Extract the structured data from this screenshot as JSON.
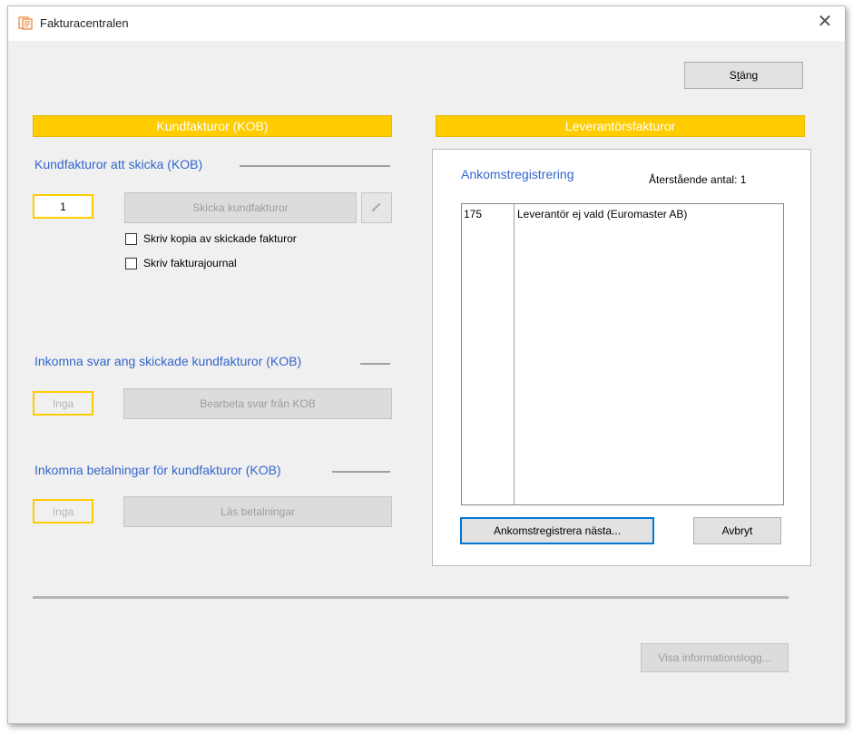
{
  "window": {
    "title": "Fakturacentralen"
  },
  "buttons": {
    "close_first": "S",
    "close_underlined": "t",
    "close_rest": "äng",
    "send_invoices": "Skicka kundfakturor",
    "process_replies": "Bearbeta svar från KOB",
    "read_payments": "Läs betalningar",
    "register_next": "Ankomstregistrera nästa...",
    "cancel": "Avbryt",
    "show_log": "Visa informationslogg..."
  },
  "customer": {
    "header": "Kundfakturor (KOB)",
    "to_send": {
      "title": "Kundfakturor att skicka (KOB)",
      "count": "1",
      "checkbox_copy": "Skriv kopia av skickade fakturor",
      "checkbox_journal": "Skriv fakturajournal"
    },
    "replies": {
      "title": "Inkomna svar ang skickade kundfakturor (KOB)",
      "count": "Inga"
    },
    "payments": {
      "title": "Inkomna betalningar för kundfakturor (KOB)",
      "count": "Inga"
    }
  },
  "supplier": {
    "header": "Leverantörsfakturor",
    "arrival": {
      "title": "Ankomstregistrering",
      "remaining_label": "Återstående antal: 1",
      "rows": [
        {
          "number": "175",
          "text": "Leverantör ej vald (Euromaster AB)"
        }
      ]
    }
  },
  "colors": {
    "accent_yellow": "#ffcc00",
    "group_title_blue": "#3366cc"
  }
}
